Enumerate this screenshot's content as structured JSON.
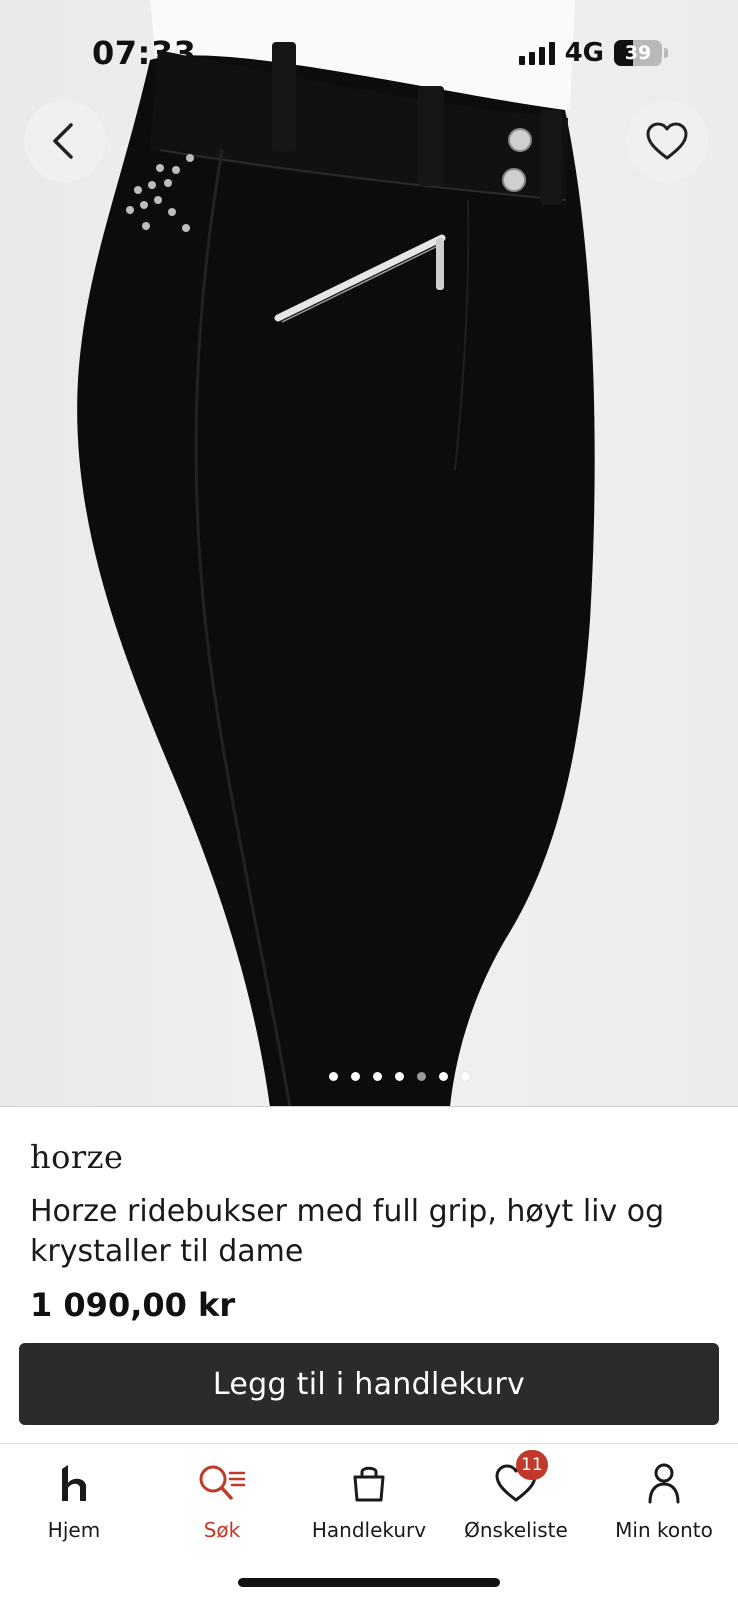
{
  "status_bar": {
    "time": "07:33",
    "network": "4G",
    "battery_pct": "39",
    "battery_level": 0.39
  },
  "hero": {
    "back_icon": "chevron-left-icon",
    "favorite_icon": "heart-outline-icon",
    "carousel": {
      "total": 7,
      "active_index": 4
    }
  },
  "product": {
    "brand": "horze",
    "title": "Horze ridebukser med full grip, høyt liv og krystaller til dame",
    "price": "1 090,00 kr"
  },
  "cta": {
    "label": "Legg til i handlekurv"
  },
  "tabbar": {
    "items": [
      {
        "label": "Hjem",
        "icon": "home-logo-icon"
      },
      {
        "label": "Søk",
        "icon": "search-icon"
      },
      {
        "label": "Handlekurv",
        "icon": "bag-icon"
      },
      {
        "label": "Ønskeliste",
        "icon": "heart-icon",
        "badge": "11"
      },
      {
        "label": "Min konto",
        "icon": "user-icon"
      }
    ],
    "active_index": 1
  },
  "colors": {
    "accent": "#c0392b",
    "cta_bg": "#2b2b2d",
    "text": "#1a1a1a"
  }
}
